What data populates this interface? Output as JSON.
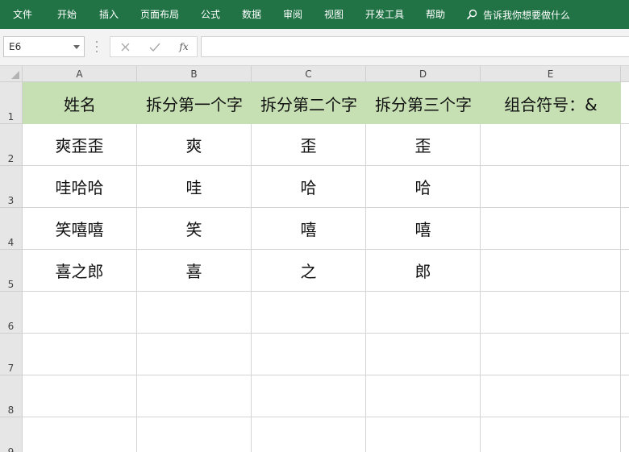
{
  "ribbon": {
    "tabs": [
      "文件",
      "开始",
      "插入",
      "页面布局",
      "公式",
      "数据",
      "审阅",
      "视图",
      "开发工具",
      "帮助"
    ],
    "tell_me": "告诉我你想要做什么"
  },
  "formula_bar": {
    "name_box": "E6",
    "formula": ""
  },
  "columns": [
    "A",
    "B",
    "C",
    "D",
    "E"
  ],
  "rows": [
    "1",
    "2",
    "3",
    "4",
    "5",
    "6",
    "7",
    "8",
    "9"
  ],
  "header_row": [
    "姓名",
    "拆分第一个字",
    "拆分第二个字",
    "拆分第三个字",
    "组合符号：&"
  ],
  "data_rows": [
    [
      "爽歪歪",
      "爽",
      "歪",
      "歪",
      ""
    ],
    [
      "哇哈哈",
      "哇",
      "哈",
      "哈",
      ""
    ],
    [
      "笑嘻嘻",
      "笑",
      "嘻",
      "嘻",
      ""
    ],
    [
      "喜之郎",
      "喜",
      "之",
      "郎",
      ""
    ]
  ],
  "colors": {
    "ribbon": "#217346",
    "header_fill": "#c6e0b4"
  }
}
